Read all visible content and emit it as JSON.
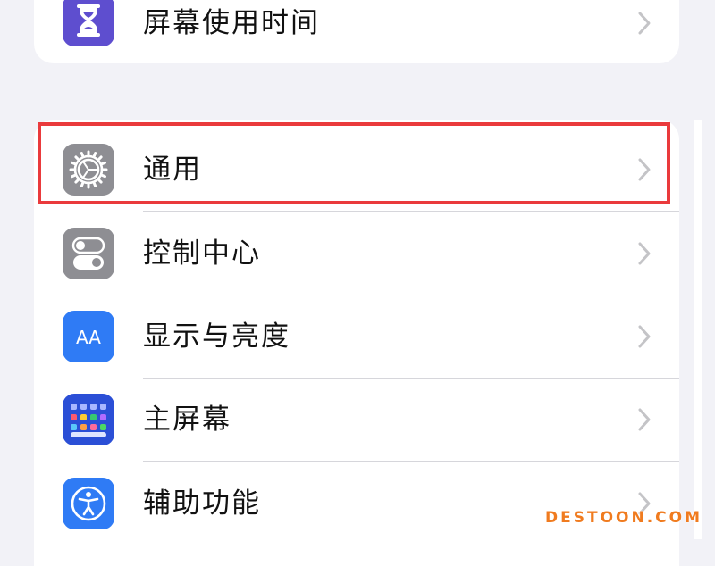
{
  "settings_groups": [
    {
      "rows": [
        {
          "label": "屏幕使用时间",
          "icon": "hourglass-icon",
          "icon_color": "#5e4ecf"
        }
      ]
    },
    {
      "rows": [
        {
          "label": "通用",
          "icon": "gear-icon",
          "icon_color": "#8e8e93",
          "highlighted": true
        },
        {
          "label": "控制中心",
          "icon": "toggles-icon",
          "icon_color": "#8e8e93"
        },
        {
          "label": "显示与亮度",
          "icon": "text-size-icon",
          "icon_color": "#2f7bf5",
          "icon_text": "AA"
        },
        {
          "label": "主屏幕",
          "icon": "home-screen-grid-icon",
          "icon_color": "#2b4fd6"
        },
        {
          "label": "辅助功能",
          "icon": "accessibility-icon",
          "icon_color": "#2f7bf5"
        }
      ]
    }
  ],
  "highlight_color": "#ea3a3c",
  "watermark": "DESTOON.COM",
  "watermark_color": "#f07b1f"
}
